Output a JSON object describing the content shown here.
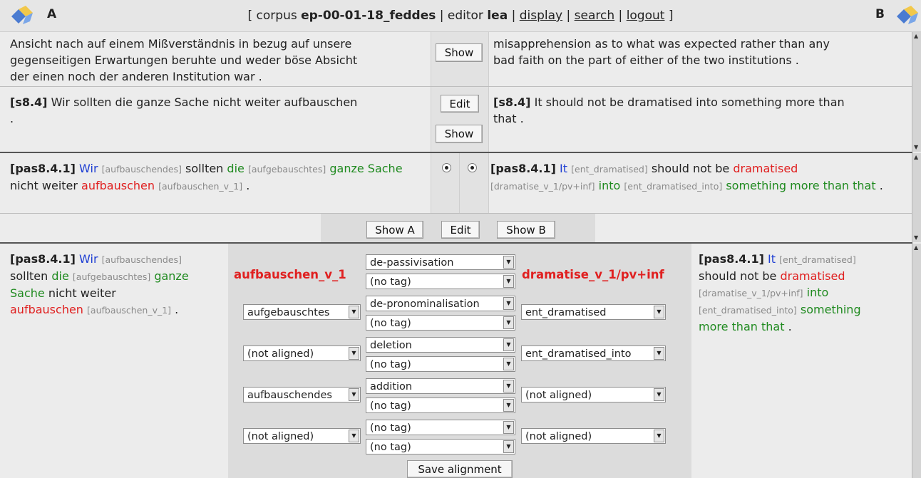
{
  "header": {
    "side_a": "A",
    "side_b": "B",
    "bracket_open": "[ corpus",
    "corpus_name": "ep-00-01-18_feddes",
    "sep1": "| editor",
    "editor_name": "lea",
    "sep2": "|",
    "display_link": "display",
    "sep3": "|",
    "search_link": "search",
    "sep4": "|",
    "logout_link": "logout",
    "bracket_close": "]"
  },
  "sentences": {
    "prev_a": [
      "Ansicht nach auf einem Mißverständnis in bezug auf unsere",
      "gegenseitigen Erwartungen beruhte und weder böse Absicht",
      "der einen noch der anderen Institution war ."
    ],
    "prev_b": [
      "misapprehension as to what was expected rather than any",
      "bad faith on the part of either of the two institutions ."
    ],
    "prev_show": "Show",
    "s_id": "[s8.4]",
    "s_a_text": "Wir sollten die ganze Sache nicht weiter aufbauschen",
    "s_a_period": ".",
    "s_b_text": "It should not be dramatised into something more than",
    "s_b_line2": "that .",
    "edit_label": "Edit",
    "show_label": "Show"
  },
  "pas_top": {
    "id": "[pas8.4.1]",
    "a": {
      "w1": "Wir",
      "t1": "[aufbauschendes]",
      "w2": "sollten",
      "w3": "die",
      "t2": "[aufgebauschtes]",
      "w4": "ganze",
      "w5": "Sache",
      "w6": "nicht weiter",
      "w7": "aufbauschen",
      "t3": "[aufbauschen_v_1]",
      "w8": "."
    },
    "b": {
      "w1": "It",
      "t1": "[ent_dramatised]",
      "w2": "should not be",
      "w3": "dramatised",
      "t2": "[dramatise_v_1/pv+inf]",
      "w4": "into",
      "t3": "[ent_dramatised_into]",
      "w5": "something more",
      "w6": "than that",
      "w7": "."
    },
    "show_a": "Show A",
    "edit": "Edit",
    "show_b": "Show B"
  },
  "alignment": {
    "left": {
      "id": "[pas8.4.1]",
      "w1": "Wir",
      "t1": "[aufbauschendes]",
      "w2": "sollten",
      "w3": "die",
      "t2": "[aufgebauschtes]",
      "w4": "ganze",
      "w5": "Sache",
      "w6": "nicht weiter",
      "w7": "aufbauschen",
      "t3": "[aufbauschen_v_1]",
      "w8": "."
    },
    "right": {
      "id": "[pas8.4.1]",
      "w1": "It",
      "t1": "[ent_dramatised]",
      "w2": "should not be",
      "w3": "dramatised",
      "t2": "[dramatise_v_1/pv+inf]",
      "w4": "into",
      "t3": "[ent_dramatised_into]",
      "w5": "something",
      "w6": "more than that",
      "w7": "."
    },
    "pred_a": "aufbauschen_v_1",
    "pred_b": "dramatise_v_1/pv+inf",
    "rows": [
      {
        "left": "",
        "ops": [
          "de-passivisation",
          "(no tag)"
        ],
        "right": ""
      },
      {
        "left": "aufgebauschtes",
        "ops": [
          "de-pronominalisation",
          "(no tag)"
        ],
        "right": "ent_dramatised"
      },
      {
        "left": "(not aligned)",
        "ops": [
          "deletion",
          "(no tag)"
        ],
        "right": "ent_dramatised_into"
      },
      {
        "left": "aufbauschendes",
        "ops": [
          "addition",
          "(no tag)"
        ],
        "right": "(not aligned)"
      },
      {
        "left": "(not aligned)",
        "ops": [
          "(no tag)",
          "(no tag)"
        ],
        "right": "(not aligned)"
      }
    ],
    "save_label": "Save alignment"
  },
  "colors": {
    "source_word": "#1f3fd3",
    "aligned_word": "#1f8a1f",
    "predicate": "#e02020"
  }
}
